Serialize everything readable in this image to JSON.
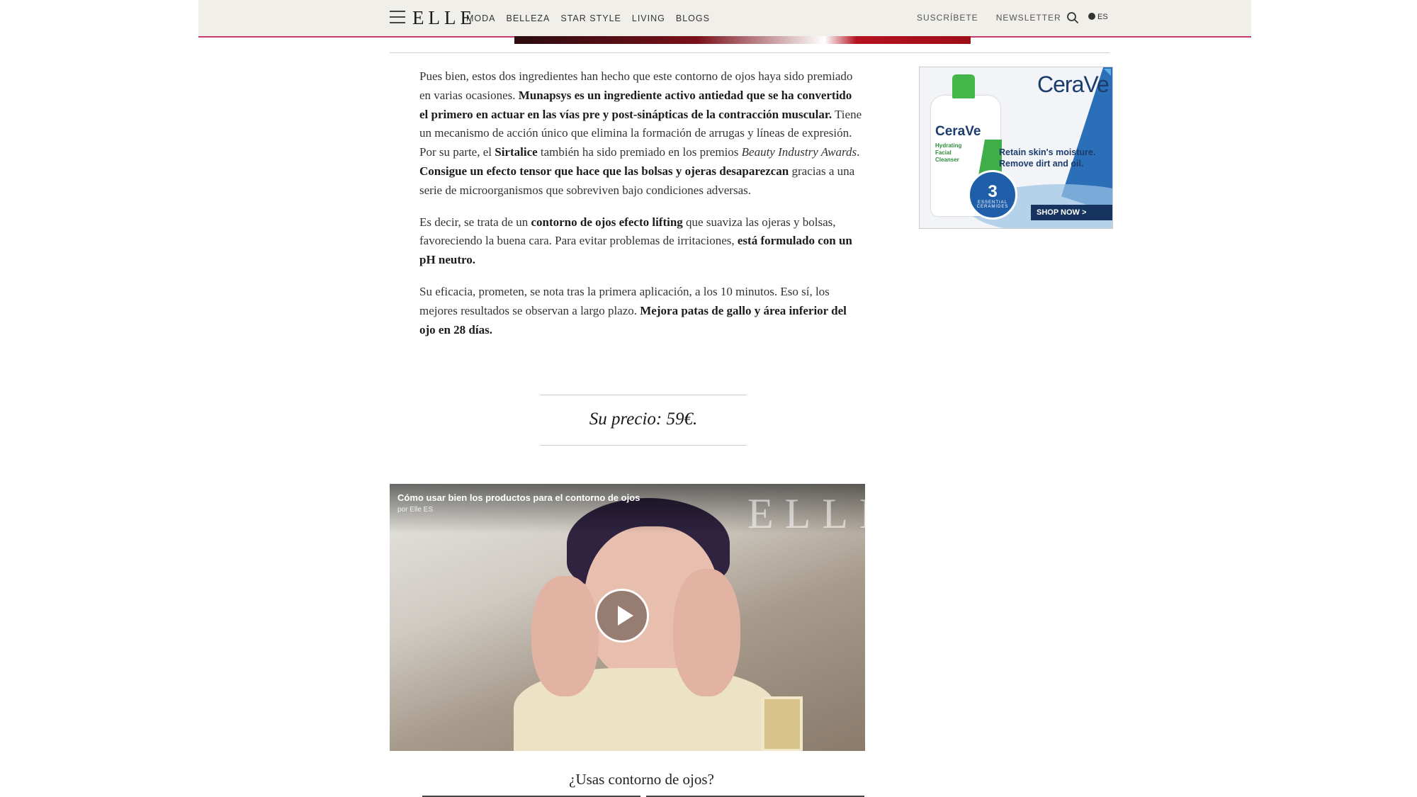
{
  "header": {
    "logo": "ELLE",
    "nav": [
      "MODA",
      "BELLEZA",
      "STAR STYLE",
      "LIVING",
      "BLOGS"
    ],
    "subscribe": "SUSCRÍBETE",
    "newsletter": "NEWSLETTER",
    "lang": "ES",
    "icons": [
      "menu-icon",
      "search-icon",
      "globe-icon"
    ],
    "accent_color": "#c43b6c"
  },
  "article": {
    "p1": {
      "t1": "Pues bien, estos dos ingredientes han hecho que este contorno de ojos haya sido premiado en varias ocasiones. ",
      "b1": "Munapsys es un ingrediente activo antiedad que se ha convertido el primero en actuar en las vías pre y post-sinápticas de la contracción muscular.",
      "t2": " Tiene un mecanismo de acción único que elimina la formación de arrugas y líneas de expresión. Por su parte, el ",
      "b2": "Sirtalice",
      "t3": " también ha sido premiado en los premios ",
      "i1": "Beauty Industry Awards",
      "t4": ". ",
      "b3": "Consigue un efecto tensor que hace que las bolsas y ojeras desaparezcan",
      "t5": " gracias a una serie de microorganismos que sobreviven bajo condiciones adversas."
    },
    "p2": {
      "t1": "Es decir, se trata de un ",
      "b1": "contorno de ojos efecto lifting",
      "t2": " que suaviza las ojeras y bolsas, favoreciendo la buena cara. Para evitar problemas de irritaciones, ",
      "b2": "está formulado con un pH neutro."
    },
    "p3": {
      "t1": "Su eficacia, prometen, se nota tras la primera aplicación, a los 10 minutos. Eso sí, los mejores resultados se observan a largo plazo. ",
      "b1": "Mejora patas de gallo y área inferior del ojo en 28 días."
    },
    "price": "Su precio: 59€."
  },
  "video": {
    "title": "Cómo usar bien los productos para el contorno de ojos",
    "byline": "por Elle ES",
    "watermark": "ELLE"
  },
  "poll": {
    "question": "¿Usas contorno de ojos?"
  },
  "ad": {
    "brand": "CeraVe",
    "product_brand": "CeraVe",
    "product_label": "Hydrating Facial Cleanser",
    "badge_number": "3",
    "badge_caption": "ESSENTIAL CERAMIDES",
    "tagline": "Retain skin's moisture. Remove dirt and oil.",
    "cta": "SHOP NOW >"
  }
}
